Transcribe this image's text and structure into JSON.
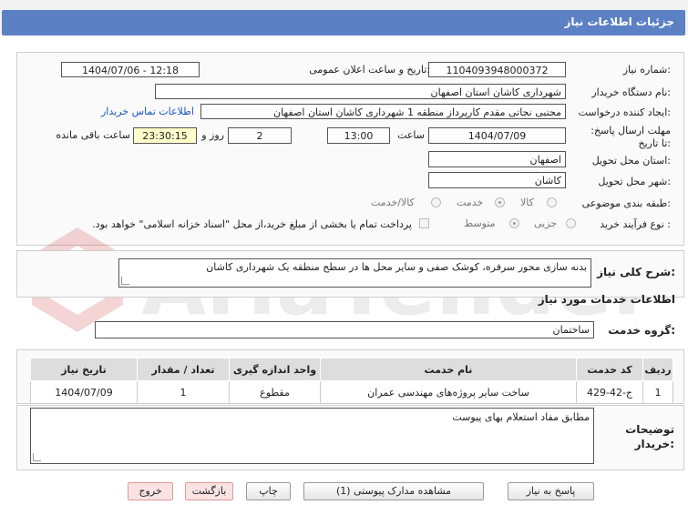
{
  "header": {
    "title": "جزئیات اطلاعات نیاز"
  },
  "watermark": {
    "text": "AriaTender.net"
  },
  "details": {
    "need_number_label": "شماره نیاز:",
    "need_number": "1104093948000372",
    "announce_label": "تاریخ و ساعت اعلان عمومی:",
    "announce_value": "1404/07/06 - 12:18",
    "buyer_org_label": "نام دستگاه خریدار:",
    "buyer_org": "شهرداری کاشان استان اصفهان",
    "requester_label": "ایجاد کننده درخواست:",
    "requester": "مجتبی نجاتی مقدم کارپرداز منطقه 1 شهرداری کاشان استان اصفهان",
    "contact_link": "اطلاعات تماس خریدار",
    "deadline_label": "مهلت ارسال پاسخ: تا تاریخ:",
    "deadline_date": "1404/07/09",
    "time_label": "ساعت",
    "deadline_time": "13:00",
    "days_value": "2",
    "days_label": "روز و",
    "remaining_time": "23:30:15",
    "remaining_label": "ساعت باقی مانده",
    "province_label": "استان محل تحویل:",
    "province": "اصفهان",
    "city_label": "شهر محل تحویل:",
    "city": "کاشان",
    "category_label": "طبقه بندی موضوعی:",
    "category_options": [
      "کالا",
      "خدمت",
      "کالا/خدمت"
    ],
    "process_label": "نوع فرآیند خرید :",
    "process_options": [
      "جزیی",
      "متوسط"
    ],
    "payment_note": "پرداخت تمام یا بخشی از مبلغ خرید،از محل \"اسناد خزانه اسلامی\" خواهد بود."
  },
  "summary": {
    "label": "شرح کلی نیاز:",
    "text": "بدنه سازی محور سرفره، کوشک صفی و سایر محل ها در سطح منطقه یک شهرداری کاشان"
  },
  "services": {
    "section_title": "اطلاعات خدمات مورد نیاز",
    "group_label": "گروه خدمت:",
    "group_value": "ساختمان",
    "columns": [
      "ردیف",
      "کد خدمت",
      "نام خدمت",
      "واحد اندازه گیری",
      "تعداد / مقدار",
      "تاریخ نیاز"
    ],
    "rows": [
      [
        "1",
        "ج-42-429",
        "ساخت سایر پروژه‌های مهندسی عمران",
        "مقطوع",
        "1",
        "1404/07/09"
      ]
    ]
  },
  "buyer_notes": {
    "label": "توضیحات خریدار:",
    "text": "مطابق مفاد استعلام بهای پیوست"
  },
  "buttons": {
    "reply": "پاسخ به نیاز",
    "view_docs": "مشاهده مدارک پیوستی (1)",
    "print": "چاپ",
    "back": "بازگشت",
    "exit": "خروج"
  }
}
